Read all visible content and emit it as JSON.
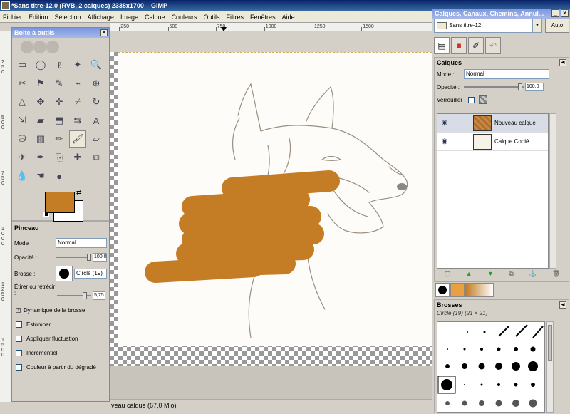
{
  "window": {
    "title": "*Sans titre-12.0 (RVB, 2 calques) 2338x1700 – GIMP"
  },
  "menu": [
    "Fichier",
    "Édition",
    "Sélection",
    "Affichage",
    "Image",
    "Calque",
    "Couleurs",
    "Outils",
    "Filtres",
    "Fenêtres",
    "Aide"
  ],
  "ruler": {
    "ticks": [
      "250",
      "500",
      "750",
      "1000",
      "1250",
      "1500"
    ],
    "vticks": [
      "250",
      "500",
      "750",
      "1000",
      "1250",
      "1500"
    ]
  },
  "status": {
    "text": "veau calque (67,0 Mio)"
  },
  "toolbox": {
    "title": "Boîte à outils",
    "tools": [
      {
        "icon": "rect-select-icon",
        "glyph": "▭"
      },
      {
        "icon": "ellipse-select-icon",
        "glyph": "◯"
      },
      {
        "icon": "lasso-icon",
        "glyph": "ℓ"
      },
      {
        "icon": "fuzzy-select-icon",
        "glyph": "✦"
      },
      {
        "icon": "zoom-icon",
        "glyph": "🔍"
      },
      {
        "icon": "scissors-icon",
        "glyph": "✂"
      },
      {
        "icon": "foreground-select-icon",
        "glyph": "⚑"
      },
      {
        "icon": "paths-icon",
        "glyph": "✎"
      },
      {
        "icon": "color-picker-icon",
        "glyph": "⌁"
      },
      {
        "icon": "magnify-icon",
        "glyph": "⊕"
      },
      {
        "icon": "measure-icon",
        "glyph": "△"
      },
      {
        "icon": "move-icon",
        "glyph": "✥"
      },
      {
        "icon": "align-icon",
        "glyph": "✛"
      },
      {
        "icon": "crop-icon",
        "glyph": "⌿"
      },
      {
        "icon": "rotate-icon",
        "glyph": "↻"
      },
      {
        "icon": "scale-icon",
        "glyph": "⇲"
      },
      {
        "icon": "shear-icon",
        "glyph": "▰"
      },
      {
        "icon": "perspective-icon",
        "glyph": "⬒"
      },
      {
        "icon": "flip-icon",
        "glyph": "⇆"
      },
      {
        "icon": "text-icon",
        "glyph": "A"
      },
      {
        "icon": "bucket-fill-icon",
        "glyph": "⛁"
      },
      {
        "icon": "gradient-icon",
        "glyph": "▥"
      },
      {
        "icon": "pencil-icon",
        "glyph": "✏"
      },
      {
        "icon": "paintbrush-icon",
        "glyph": "🖌"
      },
      {
        "icon": "eraser-icon",
        "glyph": "▱"
      },
      {
        "icon": "airbrush-icon",
        "glyph": "✈"
      },
      {
        "icon": "ink-icon",
        "glyph": "✒"
      },
      {
        "icon": "clone-icon",
        "glyph": "⎘"
      },
      {
        "icon": "heal-icon",
        "glyph": "✚"
      },
      {
        "icon": "perspective-clone-icon",
        "glyph": "⧉"
      },
      {
        "icon": "blur-icon",
        "glyph": "💧"
      },
      {
        "icon": "smudge-icon",
        "glyph": "☚"
      },
      {
        "icon": "dodge-burn-icon",
        "glyph": "●"
      }
    ],
    "active_tool_index": 23,
    "fg_color": "#c47c25",
    "bg_color": "#ffffff"
  },
  "options": {
    "title": "Pinceau",
    "mode_label": "Mode :",
    "mode_value": "Normal",
    "opacity_label": "Opacité :",
    "opacity_value": "100,0",
    "brush_label": "Brosse :",
    "brush_value": "Circle (19)",
    "scale_label": "Étirer ou rétrécir :",
    "scale_value": "5,75",
    "dynamics_label": "Dynamique de la brosse",
    "checks": [
      "Estomper",
      "Appliquer fluctuation",
      "Incrémentiel",
      "Couleur à partir du dégradé"
    ]
  },
  "dock": {
    "title": "Calques, Canaux, Chemins, Annul...",
    "image_selector": "Sans titre-12",
    "auto_label": "Auto",
    "layers_title": "Calques",
    "mode_label": "Mode :",
    "mode_value": "Normal",
    "opacity_label": "Opacité :",
    "opacity_value": "100,0",
    "lock_label": "Verrouiller :",
    "layers": [
      {
        "name": "Nouveau calque",
        "selected": true
      },
      {
        "name": "Calque Copié",
        "selected": false
      }
    ],
    "brushes_title": "Brosses",
    "brush_info": "Circle (19) (21 × 21)"
  }
}
